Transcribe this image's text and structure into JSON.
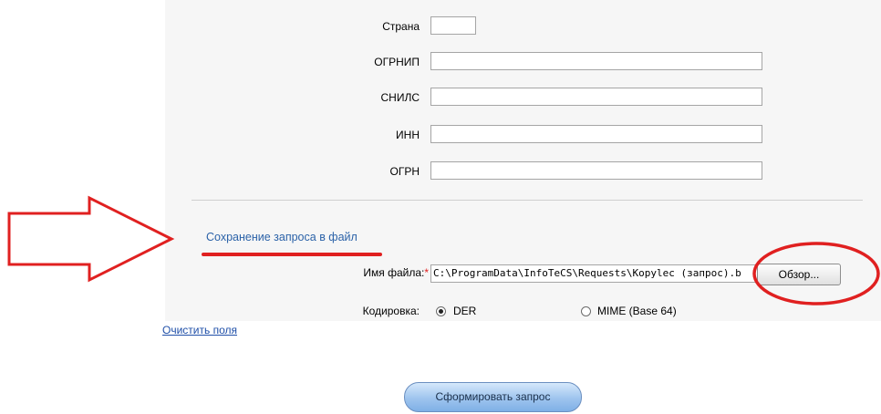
{
  "form": {
    "fields": [
      {
        "label": "Страна",
        "value": ""
      },
      {
        "label": "ОГРНИП",
        "value": ""
      },
      {
        "label": "СНИЛС",
        "value": ""
      },
      {
        "label": "ИНН",
        "value": ""
      },
      {
        "label": "ОГРН",
        "value": ""
      }
    ]
  },
  "save_section": {
    "title": "Сохранение запроса в файл",
    "filename_label": "Имя файла:",
    "required_mark": "*",
    "filename_value": "C:\\ProgramData\\InfoTeCS\\Requests\\Kopylec (запрос).b",
    "browse_label": "Обзор...",
    "encoding_label": "Кодировка:",
    "encoding_options": [
      {
        "label": "DER",
        "selected": true
      },
      {
        "label": "MIME (Base 64)",
        "selected": false
      }
    ]
  },
  "clear_link": "Очистить поля",
  "submit_label": "Сформировать запрос",
  "annotation": {
    "color": "#e02020"
  }
}
